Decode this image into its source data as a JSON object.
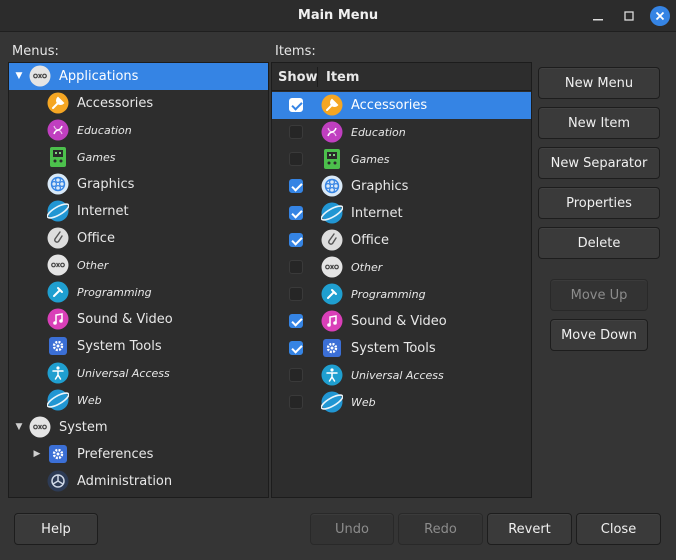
{
  "window": {
    "title": "Main Menu"
  },
  "labels": {
    "menus": "Menus:",
    "items": "Items:"
  },
  "table": {
    "col_show": "Show",
    "col_item": "Item"
  },
  "menus_tree": [
    {
      "label": "Applications",
      "level": 0,
      "expander": "down",
      "selected": true,
      "icon": "applications-icon",
      "italic": false
    },
    {
      "label": "Accessories",
      "level": 1,
      "icon": "accessories-icon",
      "italic": false
    },
    {
      "label": "Education",
      "level": 1,
      "icon": "education-icon",
      "italic": true
    },
    {
      "label": "Games",
      "level": 1,
      "icon": "games-icon",
      "italic": true
    },
    {
      "label": "Graphics",
      "level": 1,
      "icon": "graphics-icon",
      "italic": false
    },
    {
      "label": "Internet",
      "level": 1,
      "icon": "internet-icon",
      "italic": false
    },
    {
      "label": "Office",
      "level": 1,
      "icon": "office-icon",
      "italic": false
    },
    {
      "label": "Other",
      "level": 1,
      "icon": "other-icon",
      "italic": true
    },
    {
      "label": "Programming",
      "level": 1,
      "icon": "programming-icon",
      "italic": true
    },
    {
      "label": "Sound & Video",
      "level": 1,
      "icon": "sound-video-icon",
      "italic": false
    },
    {
      "label": "System Tools",
      "level": 1,
      "icon": "system-tools-icon",
      "italic": false
    },
    {
      "label": "Universal Access",
      "level": 1,
      "icon": "universal-access-icon",
      "italic": true
    },
    {
      "label": "Web",
      "level": 1,
      "icon": "web-icon",
      "italic": true
    },
    {
      "label": "System",
      "level": 0,
      "expander": "down",
      "icon": "system-icon",
      "italic": false
    },
    {
      "label": "Preferences",
      "level": 1,
      "expander": "right",
      "icon": "preferences-icon",
      "italic": false
    },
    {
      "label": "Administration",
      "level": 1,
      "icon": "administration-icon",
      "italic": false
    }
  ],
  "items": [
    {
      "label": "Accessories",
      "show": true,
      "selected": true,
      "italic": false
    },
    {
      "label": "Education",
      "show": false,
      "italic": true
    },
    {
      "label": "Games",
      "show": false,
      "italic": true
    },
    {
      "label": "Graphics",
      "show": true,
      "italic": false
    },
    {
      "label": "Internet",
      "show": true,
      "italic": false
    },
    {
      "label": "Office",
      "show": true,
      "italic": false
    },
    {
      "label": "Other",
      "show": false,
      "italic": true
    },
    {
      "label": "Programming",
      "show": false,
      "italic": true
    },
    {
      "label": "Sound & Video",
      "show": true,
      "italic": false
    },
    {
      "label": "System Tools",
      "show": true,
      "italic": false
    },
    {
      "label": "Universal Access",
      "show": false,
      "italic": true
    },
    {
      "label": "Web",
      "show": false,
      "italic": true
    }
  ],
  "side_buttons": {
    "new_menu": "New Menu",
    "new_item": "New Item",
    "new_separator": "New Separator",
    "properties": "Properties",
    "delete": "Delete",
    "move_up": "Move Up",
    "move_down": "Move Down"
  },
  "bottom_buttons": {
    "help": "Help",
    "undo": "Undo",
    "redo": "Redo",
    "revert": "Revert",
    "close": "Close"
  },
  "colors": {
    "accent": "#3584e4",
    "background": "#353535",
    "pane": "#2d2d2d"
  }
}
